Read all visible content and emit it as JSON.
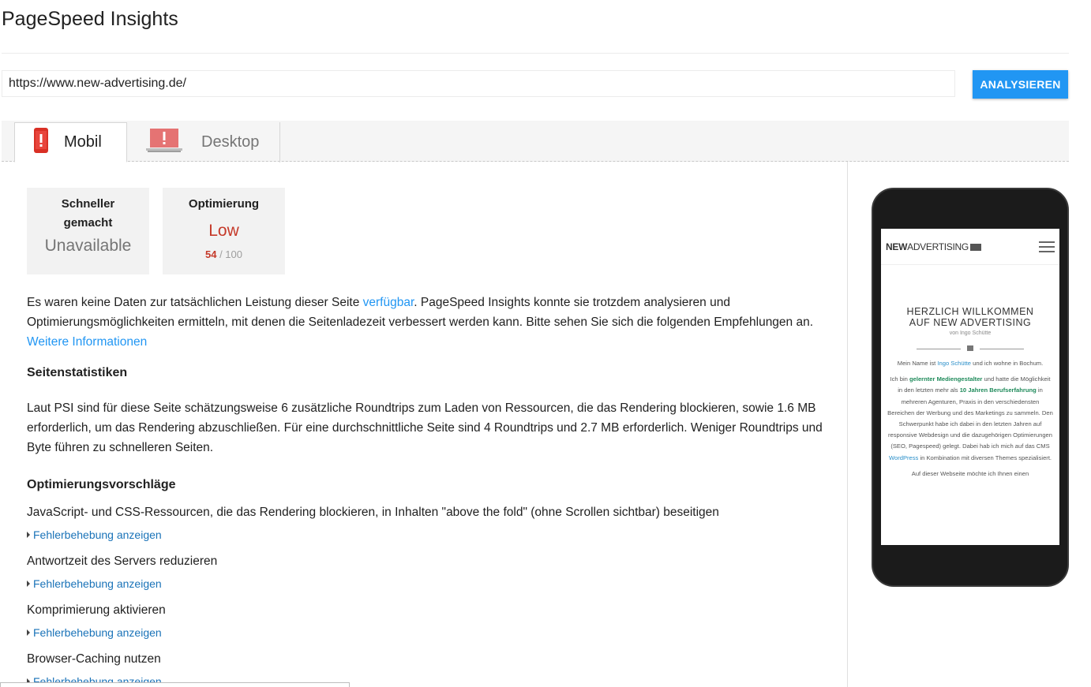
{
  "app": {
    "title": "PageSpeed Insights"
  },
  "url_bar": {
    "value": "https://www.new-advertising.de/",
    "button_label": "ANALYSIEREN"
  },
  "tabs": [
    {
      "label": "Mobil",
      "icon": "phone-warning-icon",
      "active": true
    },
    {
      "label": "Desktop",
      "icon": "laptop-warning-icon",
      "active": false
    }
  ],
  "cards": {
    "speed": {
      "heading_line1": "Schneller",
      "heading_line2": "gemacht",
      "value": "Unavailable"
    },
    "optimization": {
      "heading": "Optimierung",
      "value": "Low",
      "score": "54",
      "score_max": "/ 100"
    }
  },
  "intro": {
    "text_before": "Es waren keine Daten zur tatsächlichen Leistung dieser Seite ",
    "link1": "verfügbar",
    "text_after": ". PageSpeed Insights konnte sie trotzdem analysieren und Optimierungsmöglichkeiten ermitteln, mit denen die Seitenladezeit verbessert werden kann. Bitte sehen Sie sich die folgenden Empfehlungen an.",
    "link2": "Weitere Informationen"
  },
  "stats": {
    "heading": "Seitenstatistiken",
    "text": "Laut PSI sind für diese Seite schätzungsweise 6 zusätzliche Roundtrips zum Laden von Ressourcen, die das Rendering blockieren, sowie 1.6 MB erforderlich, um das Rendering abzuschließen. Für eine durchschnittliche Seite sind 4 Roundtrips und 2.7 MB erforderlich. Weniger Roundtrips und Byte führen zu schnelleren Seiten."
  },
  "suggestions": {
    "heading": "Optimierungsvorschläge",
    "fix_label": "Fehlerbehebung anzeigen",
    "items": [
      "JavaScript- und CSS-Ressourcen, die das Rendering blockieren, in Inhalten \"above the fold\" (ohne Scrollen sichtbar) beseitigen",
      "Antwortzeit des Servers reduzieren",
      "Komprimierung aktivieren",
      "Browser-Caching nutzen"
    ]
  },
  "preview": {
    "logo_bold": "NEW",
    "logo_rest": "ADVERTISING",
    "heading_line1": "HERZLICH WILLKOMMEN",
    "heading_line2": "AUF NEW ADVERTISING",
    "sub": "von Ingo Schütte",
    "p1_a": "Mein Name ist ",
    "p1_name": "Ingo Schütte",
    "p1_b": " und ich wohne in Bochum.",
    "p2_a": "Ich bin ",
    "p2_b": "gelernter Mediengestalter",
    "p2_c": " und hatte die Möglichkeit in den letzten mehr als ",
    "p2_d": "10 Jahren Berufserfahrung",
    "p2_e": " in mehreren Agenturen, Praxis in den verschiedensten Bereichen der Werbung und des Marketings zu sammeln. Den Schwerpunkt habe ich dabei in den letzten Jahren auf responsive Webdesign und die dazugehörigen Optimierungen (SEO, Pagespeed) gelegt. Dabei hab ich mich auf das CMS ",
    "p2_f": "WordPress",
    "p2_g": " in Kombination mit diversen Themes spezialisiert.",
    "p3": "Auf dieser Webseite möchte ich Ihnen einen"
  },
  "colors": {
    "accent": "#2196f3",
    "warning": "#c53929",
    "tab_bg": "#f5f5f5"
  }
}
